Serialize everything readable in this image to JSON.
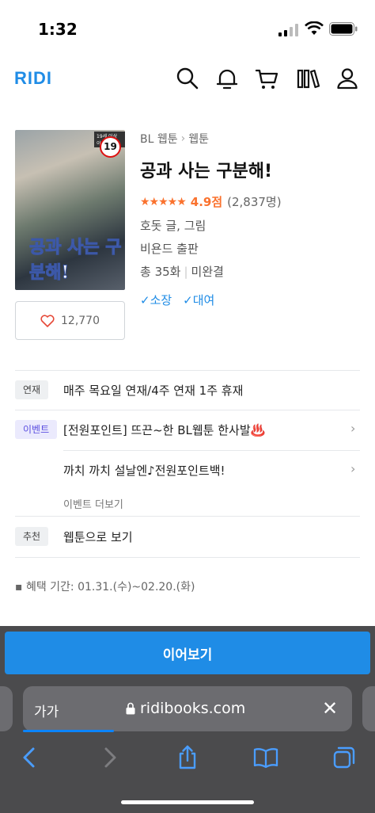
{
  "status_bar": {
    "time": "1:32"
  },
  "header": {
    "logo": "RIDI",
    "icons": [
      "search-icon",
      "bell-icon",
      "cart-icon",
      "library-icon",
      "user-icon"
    ]
  },
  "book": {
    "cover": {
      "age_badge": "19",
      "cover_title": "공과 사는 구분해!",
      "top_label": "19세 이상 이용가"
    },
    "breadcrumb": [
      "BL 웹툰",
      "웹툰"
    ],
    "title": "공과 사는 구분해!",
    "rating": {
      "stars": "★★★★★",
      "score": "4.9점",
      "count": "(2,837명)"
    },
    "author": "호돗 글, 그림",
    "publisher": "비욘드 출판",
    "episodes": "총 35화",
    "completion": "미완결",
    "actions": [
      "✓소장",
      "✓대여"
    ],
    "likes": "12,770"
  },
  "info": {
    "serial": {
      "tag": "연재",
      "text": "매주 목요일 연재/4주 연재 1주 휴재"
    },
    "event": {
      "tag": "이벤트",
      "items": [
        "[전원포인트] 뜨끈~한 BL웹툰 한사발♨️",
        "까치 까치 설날엔♪전원포인트백!"
      ],
      "more": "이벤트 더보기"
    },
    "recommend": {
      "tag": "추천",
      "text": "웹툰으로 보기"
    },
    "period": "▪ 혜택 기간: 01.31.(수)~02.20.(화)"
  },
  "cta": {
    "label": "이어보기"
  },
  "browser": {
    "text_size": "가가",
    "url": "ridibooks.com"
  },
  "colors": {
    "brand": "#1f8ce6",
    "rating": "#fa722e",
    "event_tag": "#5b4ee0"
  }
}
